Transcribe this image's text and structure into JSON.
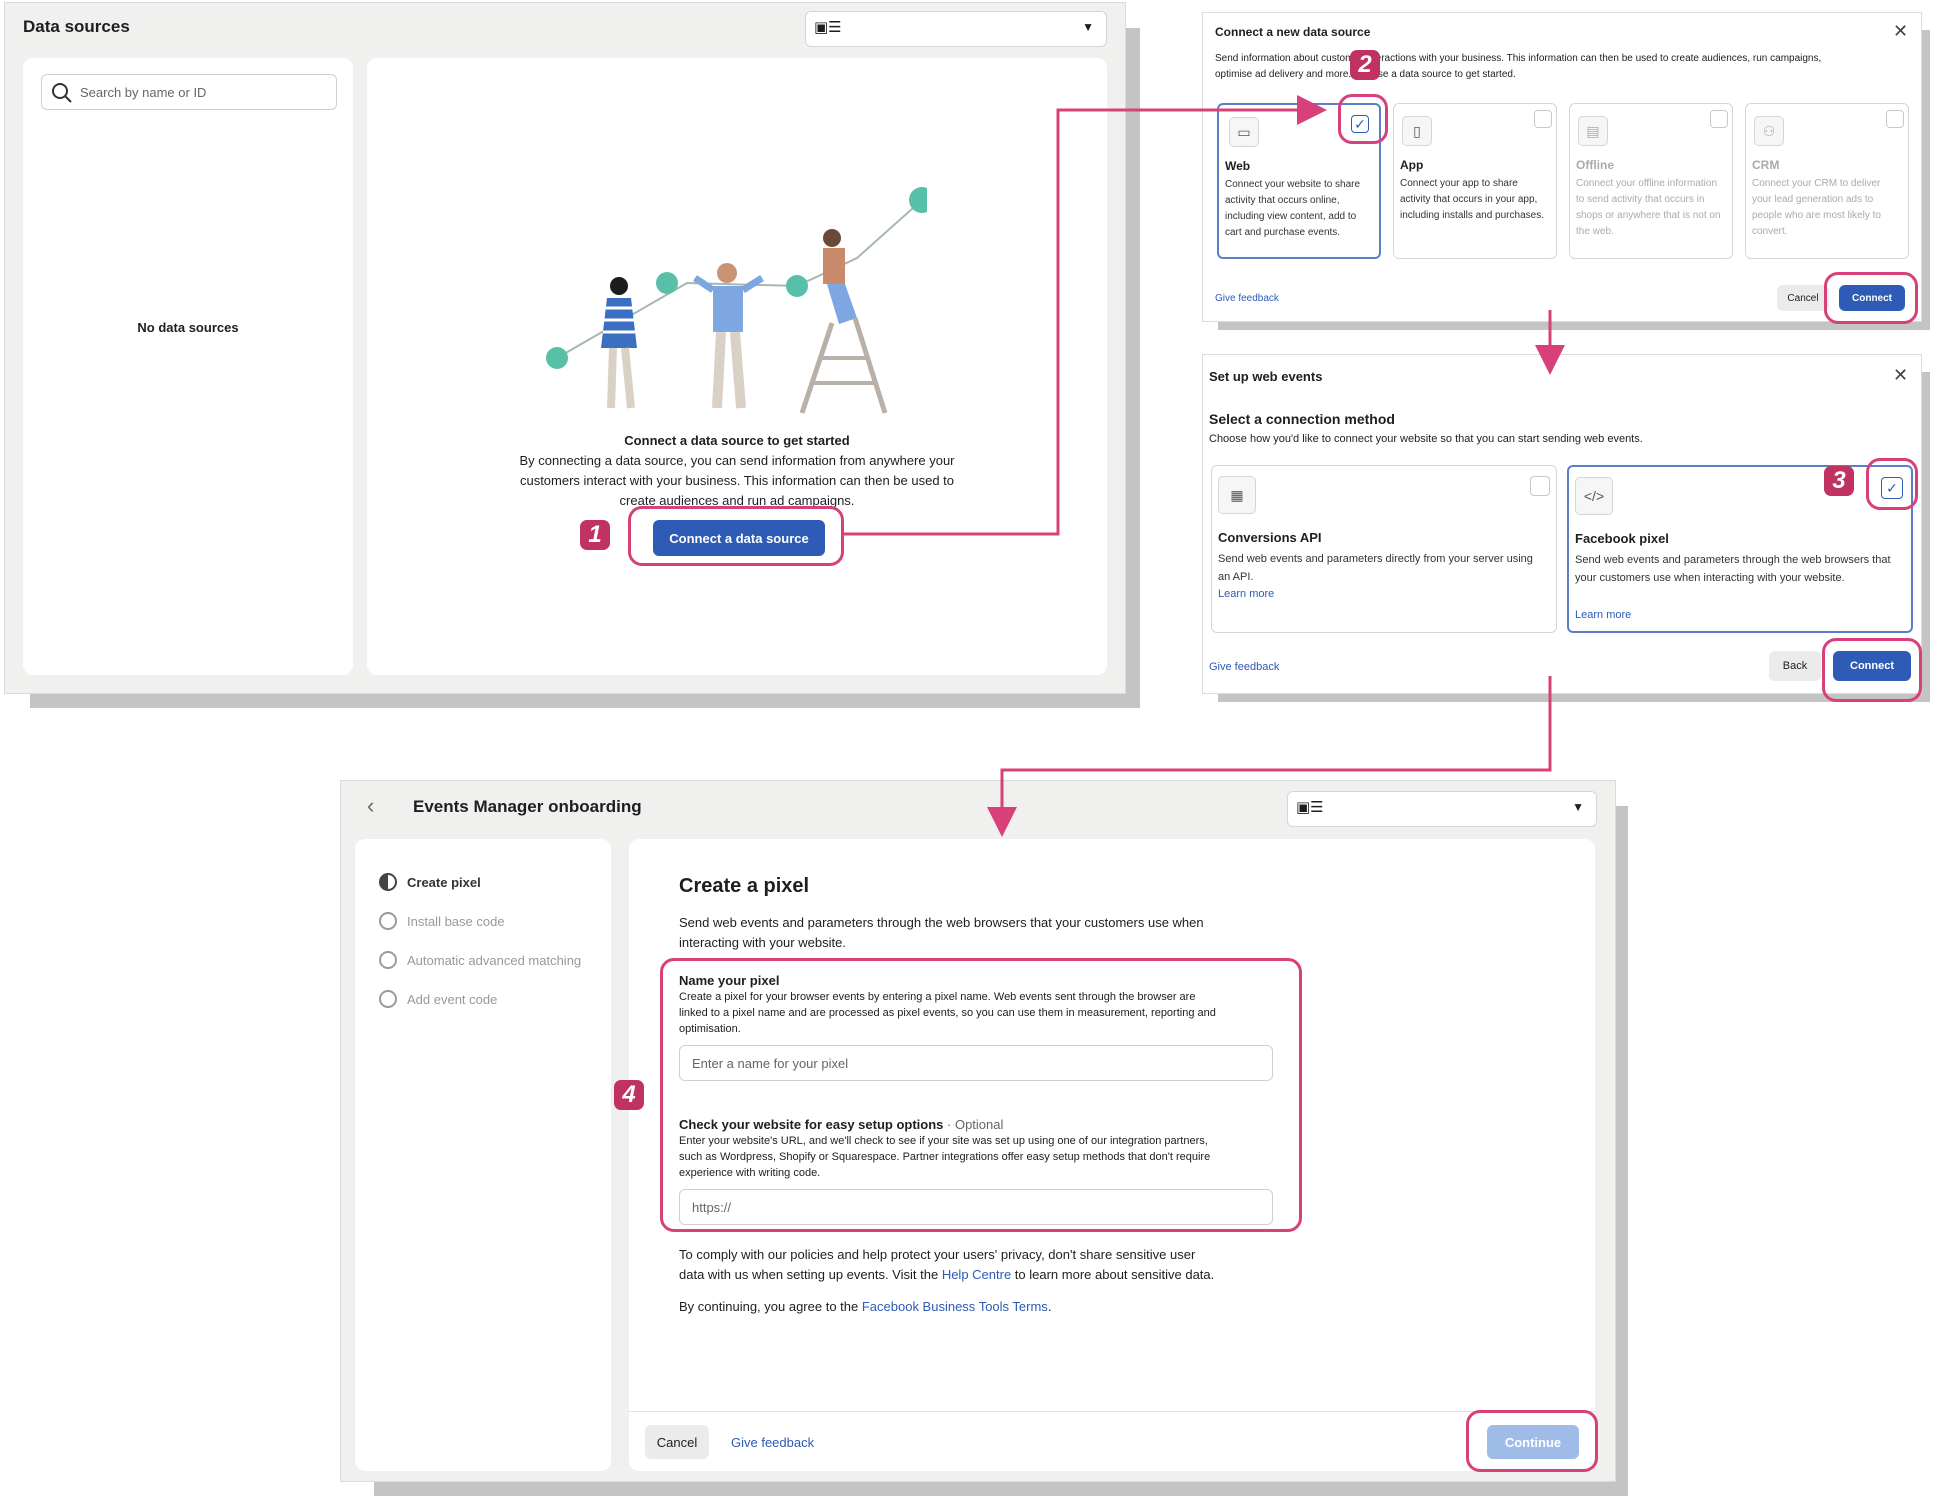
{
  "panel1": {
    "title": "Data sources",
    "search_placeholder": "Search by name or ID",
    "empty_label": "No data sources",
    "heading": "Connect a data source to get started",
    "description_line1": "By connecting a data source, you can send information from anywhere your",
    "description_line2": "customers interact with your business. This information can then be used to",
    "description_line3": "create audiences and run ad campaigns.",
    "connect_button": "Connect a data source"
  },
  "panel2": {
    "title": "Connect a new data source",
    "intro_line1": "Send information about customer interactions with your business. This information can then be used to create audiences, run campaigns,",
    "intro_line2": "optimise ad delivery and more. Choose a data source to get started.",
    "options": [
      {
        "title": "Web",
        "description": "Connect your website to share activity that occurs online, including view content, add to cart and purchase events.",
        "icon": "laptop-icon",
        "selected": true
      },
      {
        "title": "App",
        "description": "Connect your app to share activity that occurs in your app, including installs and purchases.",
        "icon": "phone-icon",
        "selected": false
      },
      {
        "title": "Offline",
        "description": "Connect your offline information to send activity that occurs in shops or anywhere that is not on the web.",
        "icon": "store-icon",
        "selected": false
      },
      {
        "title": "CRM",
        "description": "Connect your CRM to deliver your lead generation ads to people who are most likely to convert.",
        "icon": "people-icon",
        "selected": false
      }
    ],
    "give_feedback": "Give feedback",
    "cancel": "Cancel",
    "connect": "Connect"
  },
  "panel3": {
    "title": "Set up web events",
    "subtitle": "Select a connection method",
    "intro": "Choose how you'd like to connect your website so that you can start sending web events.",
    "options": [
      {
        "title": "Conversions API",
        "description": "Send web events and parameters directly from your server using an API.",
        "learn_more": "Learn more",
        "icon": "server-icon",
        "selected": false
      },
      {
        "title": "Facebook pixel",
        "description": "Send web events and parameters through the web browsers that your customers use when interacting with your website.",
        "learn_more": "Learn more",
        "icon": "code-icon",
        "selected": true
      }
    ],
    "give_feedback": "Give feedback",
    "back": "Back",
    "connect": "Connect"
  },
  "panel4": {
    "title": "Events Manager onboarding",
    "steps": [
      "Create pixel",
      "Install base code",
      "Automatic advanced matching",
      "Add event code"
    ],
    "heading": "Create a pixel",
    "description_line1": "Send web events and parameters through the web browsers that your customers use when",
    "description_line2": "interacting with your website.",
    "name_label": "Name your pixel",
    "name_help_line1": "Create a pixel for your browser events by entering a pixel name. Web events sent through the browser are",
    "name_help_line2": "linked to a pixel name and are processed as pixel events, so you can use them in measurement, reporting and",
    "name_help_line3": "optimisation.",
    "name_placeholder": "Enter a name for your pixel",
    "website_label": "Check your website for easy setup options",
    "website_optional": " · Optional",
    "website_help_line1": "Enter your website's URL, and we'll check to see if your site was set up using one of our integration partners,",
    "website_help_line2": "such as Wordpress, Shopify or Squarespace. Partner integrations offer easy setup methods that don't require",
    "website_help_line3": "experience with writing code.",
    "website_placeholder": "https://",
    "privacy_line1": "To comply with our policies and help protect your users' privacy, don't share sensitive user",
    "privacy_line2_a": "data with us when setting up events. Visit the ",
    "privacy_link": "Help Centre",
    "privacy_line2_b": " to learn more about sensitive data.",
    "terms_a": "By continuing, you agree to the ",
    "terms_link": "Facebook Business Tools Terms",
    "terms_b": ".",
    "cancel": "Cancel",
    "give_feedback": "Give feedback",
    "continue": "Continue"
  },
  "badges": [
    "1",
    "2",
    "3",
    "4"
  ],
  "colors": {
    "accent": "#2d5bb5",
    "highlight": "#d8407a",
    "badge": "#c0325f"
  }
}
